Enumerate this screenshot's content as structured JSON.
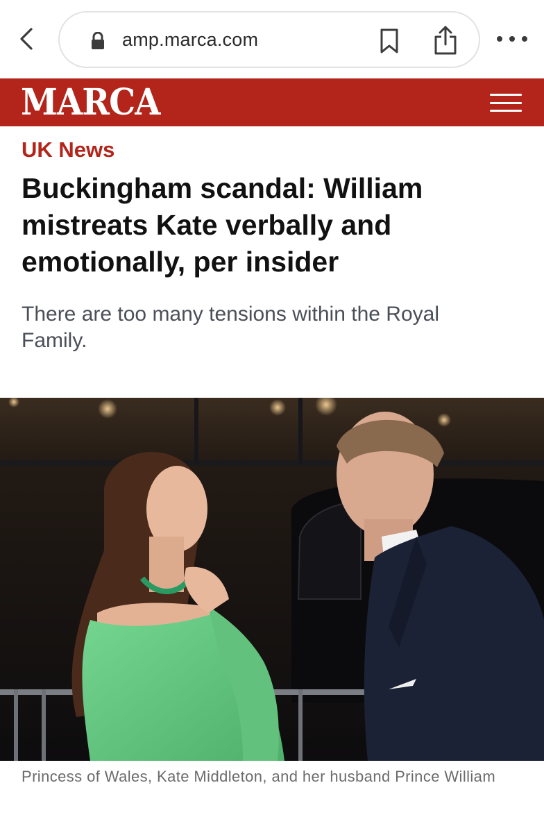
{
  "browser": {
    "url": "amp.marca.com"
  },
  "header": {
    "logo": "MARCA"
  },
  "article": {
    "section": "UK News",
    "headline": "Buckingham scandal: William mistreats Kate verbally and emotionally, per insider",
    "subtitle": "There are too many tensions within the Royal Family.",
    "caption": "Princess of Wales, Kate Middleton, and her husband Prince William"
  },
  "colors": {
    "brand_red": "#b3251a",
    "dress_green": "#63c77f",
    "suit_navy": "#1b2235"
  },
  "icons": {
    "back": "chevron-left-icon",
    "lock": "lock-icon",
    "bookmark": "bookmark-icon",
    "share": "share-icon",
    "more": "more-horizontal-icon",
    "menu": "hamburger-menu-icon"
  }
}
